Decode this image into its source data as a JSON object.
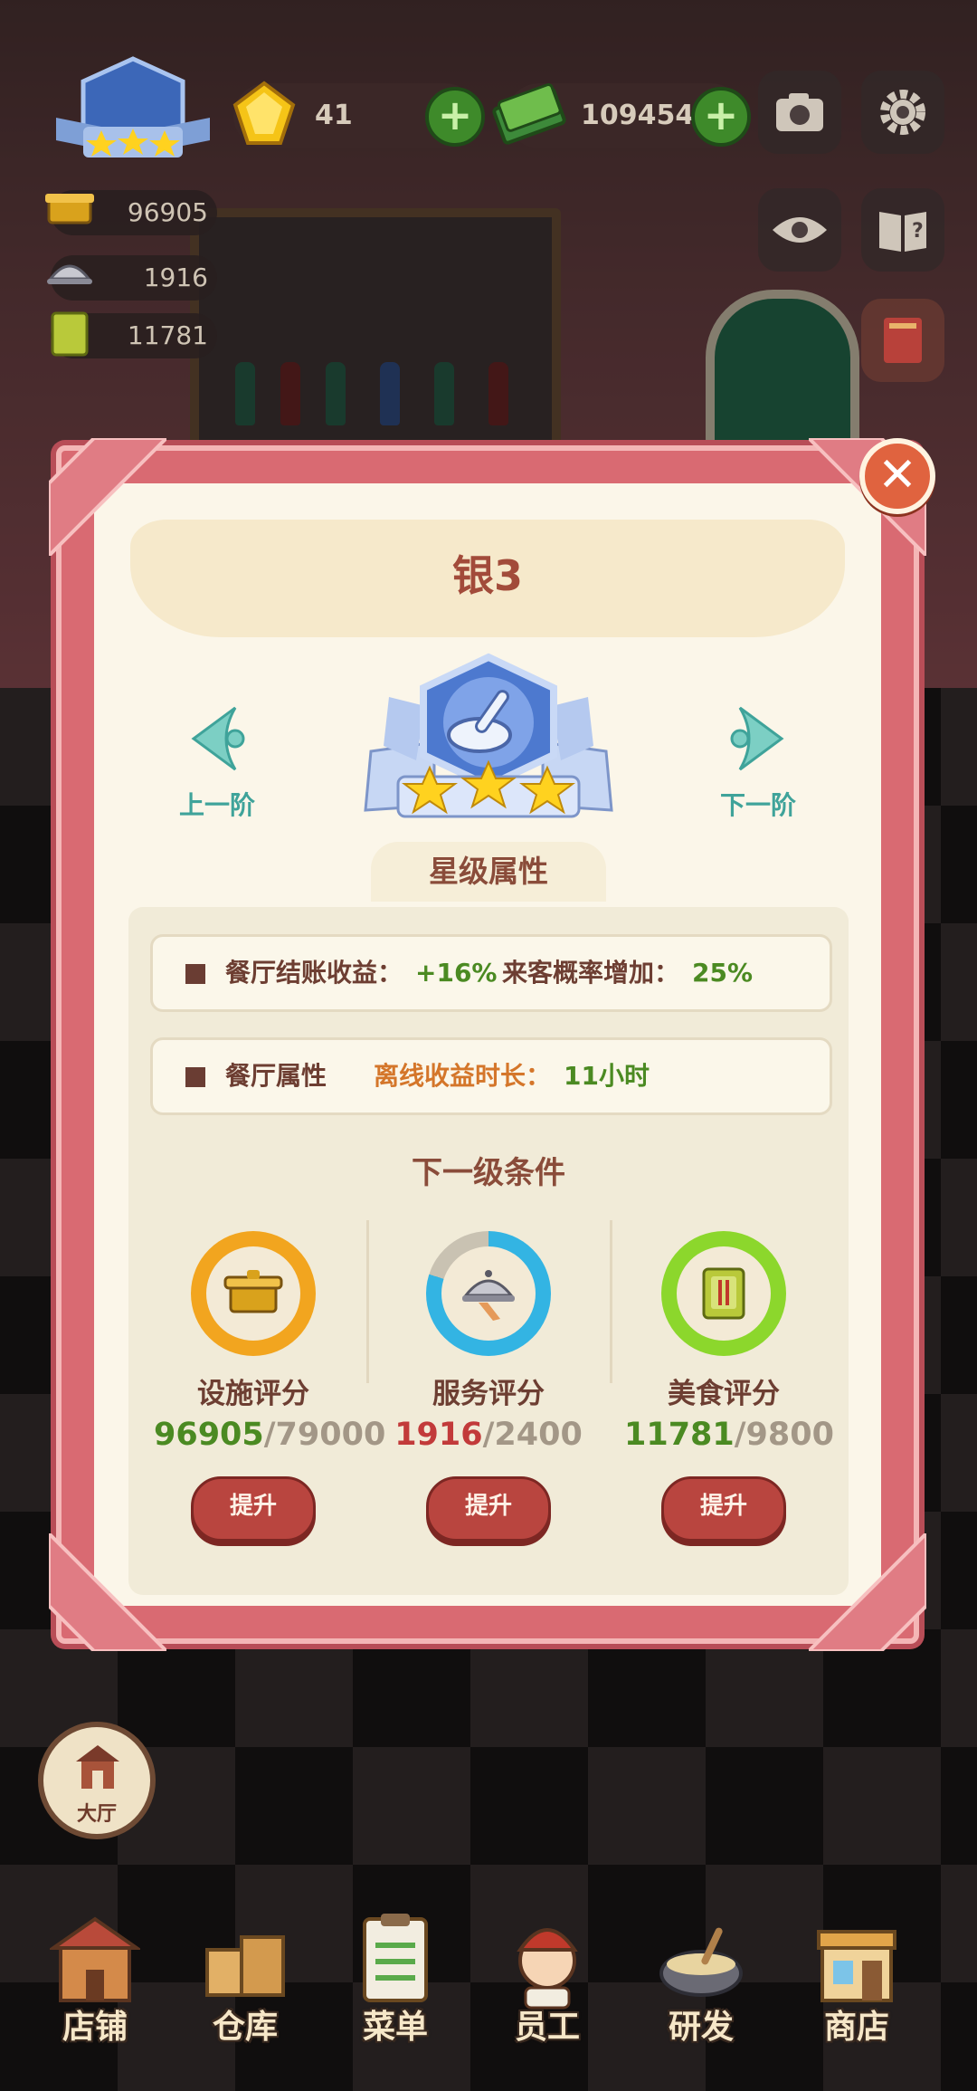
{
  "hud": {
    "gems": "41",
    "cash": "109454",
    "plus_label": "+",
    "stats": [
      {
        "icon": "facility-icon",
        "value": "96905"
      },
      {
        "icon": "service-icon",
        "value": "1916"
      },
      {
        "icon": "food-icon",
        "value": "11781"
      }
    ],
    "shelf_badge": "3"
  },
  "dialog": {
    "title": "银3",
    "prev_label": "上一阶",
    "next_label": "下一阶",
    "close_label": "✕",
    "section_title": "星级属性",
    "row1": {
      "label1": "餐厅结账收益：",
      "value1": "+16%",
      "label2": "来客概率增加：",
      "value2": "25%"
    },
    "row2": {
      "label": "餐厅属性",
      "offline_label": "离线收益时长：",
      "offline_value": "11小时"
    },
    "next_title": "下一级条件",
    "requirements": [
      {
        "name": "设施评分",
        "current": "96905",
        "target": "/79000",
        "color": "#4b8a22",
        "ring": "#f2a51f",
        "button": "提升"
      },
      {
        "name": "服务评分",
        "current": "1916",
        "target": "/2400",
        "color": "#c23a3a",
        "ring": "#33b4e3",
        "button": "提升"
      },
      {
        "name": "美食评分",
        "current": "11781",
        "target": "/9800",
        "color": "#4b8a22",
        "ring": "#8cd72c",
        "button": "提升"
      }
    ]
  },
  "hall_label": "大厅",
  "nav": [
    {
      "label": "店铺",
      "icon": "store-icon"
    },
    {
      "label": "仓库",
      "icon": "warehouse-icon"
    },
    {
      "label": "菜单",
      "icon": "menu-icon"
    },
    {
      "label": "员工",
      "icon": "staff-icon"
    },
    {
      "label": "研发",
      "icon": "research-icon"
    },
    {
      "label": "商店",
      "icon": "shop-icon"
    }
  ],
  "colors": {
    "dialog_frame": "#d96a72",
    "dialog_bg": "#fbf6e9",
    "button_red": "#b9453f",
    "teal_arrow": "#3fa39a"
  }
}
